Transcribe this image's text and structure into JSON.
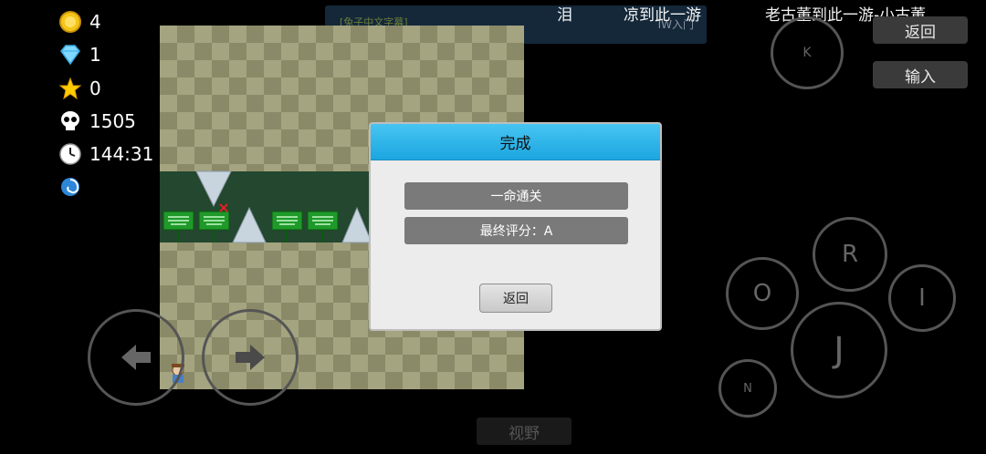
{
  "hud": {
    "coins": "4",
    "gems": "1",
    "stars": "0",
    "deaths": "1505",
    "time": "144:31"
  },
  "top": {
    "notice_left": "[兔子中文字幕]",
    "notice_right": "IW入门",
    "name1": "泪",
    "name2": "凉到此一游",
    "name3": "老古董到此一游-小古董"
  },
  "buttons": {
    "back": "返回",
    "input": "输入",
    "view": "视野",
    "k": "K",
    "r": "R",
    "o": "O",
    "i": "I",
    "j": "J",
    "n": "N"
  },
  "dialog": {
    "title": "完成",
    "line1": "一命通关",
    "line2": "最终评分：A",
    "back": "返回"
  },
  "colors": {
    "dialog_header": "#1ba6e0",
    "sign_green": "#1f9a2a",
    "background": "#000000"
  }
}
